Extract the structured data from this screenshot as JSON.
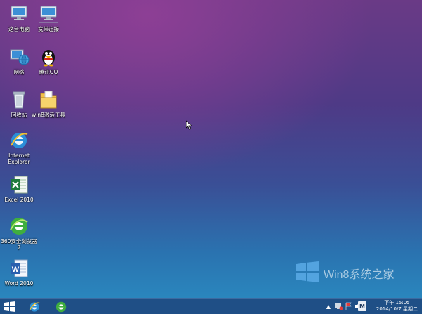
{
  "desktop_icons": [
    {
      "label": "这台电脑"
    },
    {
      "label": "宽带连接"
    },
    {
      "label": "网络"
    },
    {
      "label": "腾讯QQ"
    },
    {
      "label": "回收站"
    },
    {
      "label": "win8激活工具"
    },
    {
      "label": "Internet Explorer"
    },
    {
      "label": "Excel 2010"
    },
    {
      "label": "360安全浏览器7"
    },
    {
      "label": "Word 2010"
    }
  ],
  "watermark": {
    "text": "Win8系统之家"
  },
  "taskbar": {
    "tray": {
      "keyboard": "M"
    },
    "clock": {
      "time": "下午 15:05",
      "date": "2014/10/7 星期二"
    }
  },
  "colors": {
    "accent": "#2a86bd",
    "taskbar": "#1f4f86",
    "wallpaper_top": "#8d3f95"
  }
}
